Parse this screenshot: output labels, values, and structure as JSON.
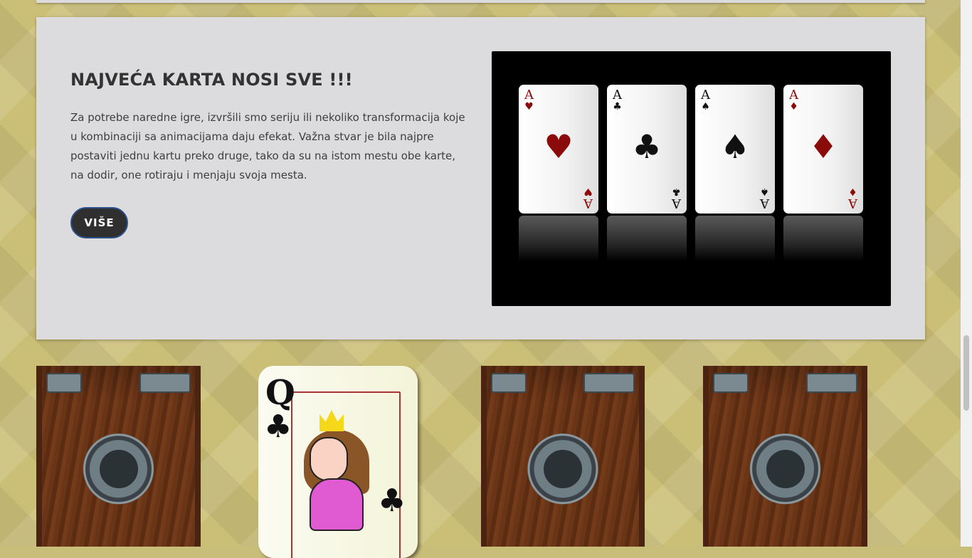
{
  "section": {
    "heading": "NAJVEĆA KARTA NOSI SVE !!!",
    "description": "Za potrebe naredne igre, izvršili smo seriju ili nekoliko transformacija koje u kombinaciji sa animacijama daju efekat. Važna stvar je bila najpre postaviti jednu kartu preko druge, tako da su na istom mestu obe karte, na dodir, one rotiraju i menjaju svoja mesta.",
    "more_label": "VIŠE"
  },
  "aces": [
    {
      "rank": "A",
      "suit": "♥",
      "color": "#8b0a0a"
    },
    {
      "rank": "A",
      "suit": "♣",
      "color": "#111111"
    },
    {
      "rank": "A",
      "suit": "♠",
      "color": "#111111"
    },
    {
      "rank": "A",
      "suit": "♦",
      "color": "#8b0a0a"
    }
  ],
  "memory_cards": [
    {
      "state": "face-down",
      "image": "iron-throne-book-cover"
    },
    {
      "state": "face-up",
      "rank": "Q",
      "suit": "♣"
    },
    {
      "state": "face-down",
      "image": "iron-throne-book-cover"
    },
    {
      "state": "face-down",
      "image": "iron-throne-book-cover"
    }
  ],
  "colors": {
    "panel": "#dcdcde",
    "background": "#cbbf78",
    "button": "#2f2f2f",
    "button_border": "#2a4f8a"
  }
}
